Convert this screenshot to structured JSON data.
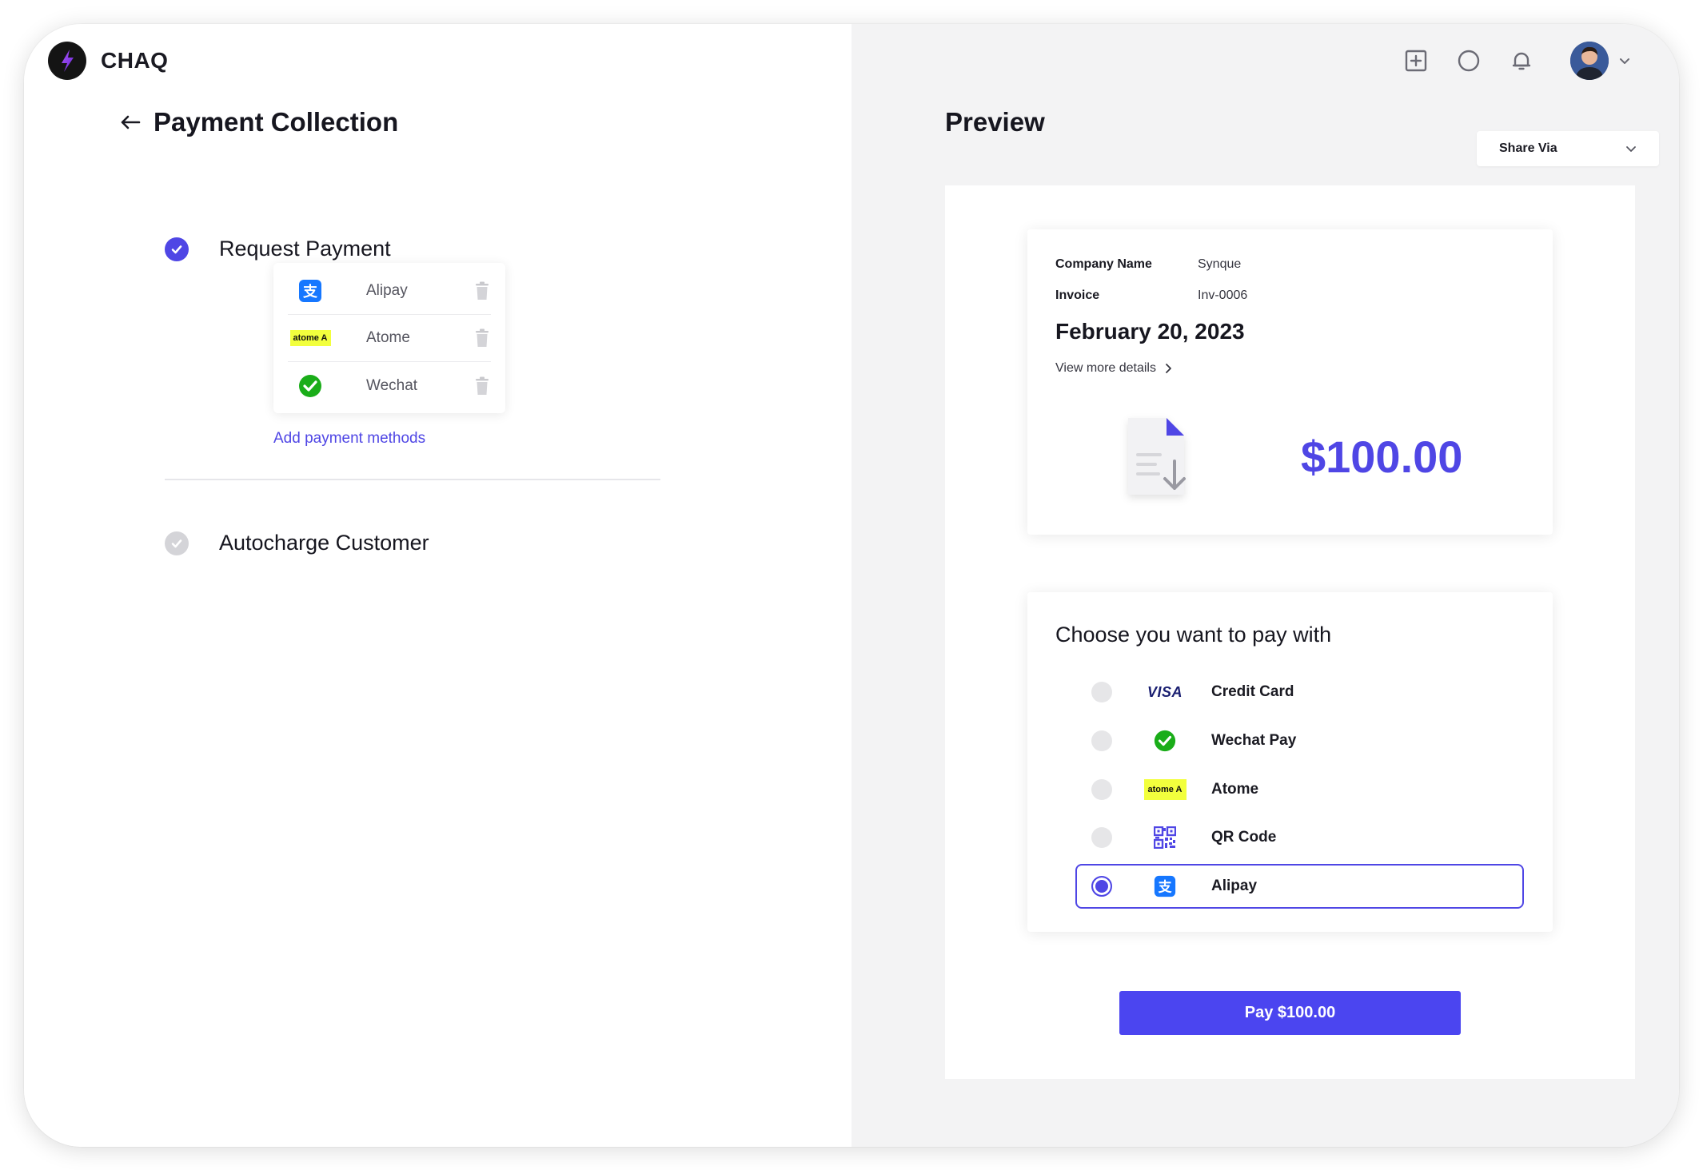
{
  "app": {
    "brand_name": "CHAQ"
  },
  "header": {
    "page_title": "Payment Collection"
  },
  "steps": {
    "request": {
      "label": "Request Payment"
    },
    "autocharge": {
      "label": "Autocharge Customer"
    }
  },
  "methods": [
    {
      "name": "Alipay",
      "icon": "alipay-logo"
    },
    {
      "name": "Atome",
      "icon": "atome-logo",
      "badge": "atome A"
    },
    {
      "name": "Wechat",
      "icon": "wechat-logo"
    }
  ],
  "add_methods_label": "Add payment methods",
  "preview": {
    "title": "Preview",
    "share_via": "Share Via",
    "invoice": {
      "company_key": "Company Name",
      "company_val": "Synque",
      "invoice_key": "Invoice",
      "invoice_val": "Inv-0006",
      "date": "February 20, 2023",
      "view_more": "View more details",
      "amount": "$100.00"
    },
    "pay": {
      "title": "Choose you want to pay with",
      "options": [
        {
          "label": "Credit Card",
          "icon": "visa-logo",
          "badge": "VISA",
          "selected": false
        },
        {
          "label": "Wechat Pay",
          "icon": "wechat-logo",
          "selected": false
        },
        {
          "label": "Atome",
          "icon": "atome-logo",
          "badge": "atome A",
          "selected": false
        },
        {
          "label": "QR Code",
          "icon": "qr-code-icon",
          "selected": false
        },
        {
          "label": "Alipay",
          "icon": "alipay-logo",
          "selected": true
        }
      ],
      "button": "Pay $100.00"
    }
  },
  "colors": {
    "accent": "#4f46e5",
    "pane_bg": "#f3f3f4",
    "wechat": "#1aad19",
    "alipay": "#1677ff",
    "atome": "#f2ff3d"
  }
}
